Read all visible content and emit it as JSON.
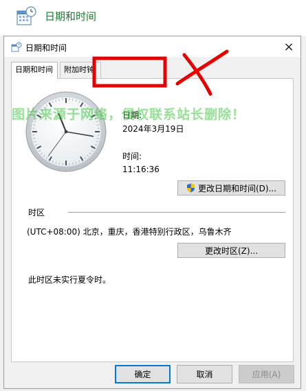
{
  "window_header": {
    "title": "日期和时间",
    "icon": "calendar-clock-icon"
  },
  "dialog": {
    "title": "日期和时间",
    "icon": "calendar-clock-icon",
    "close_glyph": "×",
    "tabs": [
      {
        "label": "日期和时间",
        "active": true
      },
      {
        "label": "附加时钟",
        "active": false
      }
    ],
    "date_label": "日期:",
    "date_value": "2024年3月19日",
    "time_label": "时间:",
    "time_value": "11:16:36",
    "clock": {
      "hour": 11,
      "minute": 16,
      "second": 36
    },
    "change_datetime_button": "更改日期和时间(D)...",
    "change_datetime_icon": "uac-shield-icon",
    "timezone_section_label": "时区",
    "timezone_value": "(UTC+08:00) 北京，重庆，香港特别行政区，乌鲁木齐",
    "change_timezone_button": "更改时区(Z)...",
    "dst_note": "此时区未实行夏令时。"
  },
  "footer": {
    "ok": "确定",
    "cancel": "取消",
    "apply": "应用(A)"
  },
  "watermark_text": "图片来源于网络，侵权联系站长删除！",
  "colors": {
    "accent_blue": "#0078d7",
    "header_green": "#1a7a2a",
    "annotation_red": "#e60000",
    "watermark_green": "#3cc83c"
  }
}
